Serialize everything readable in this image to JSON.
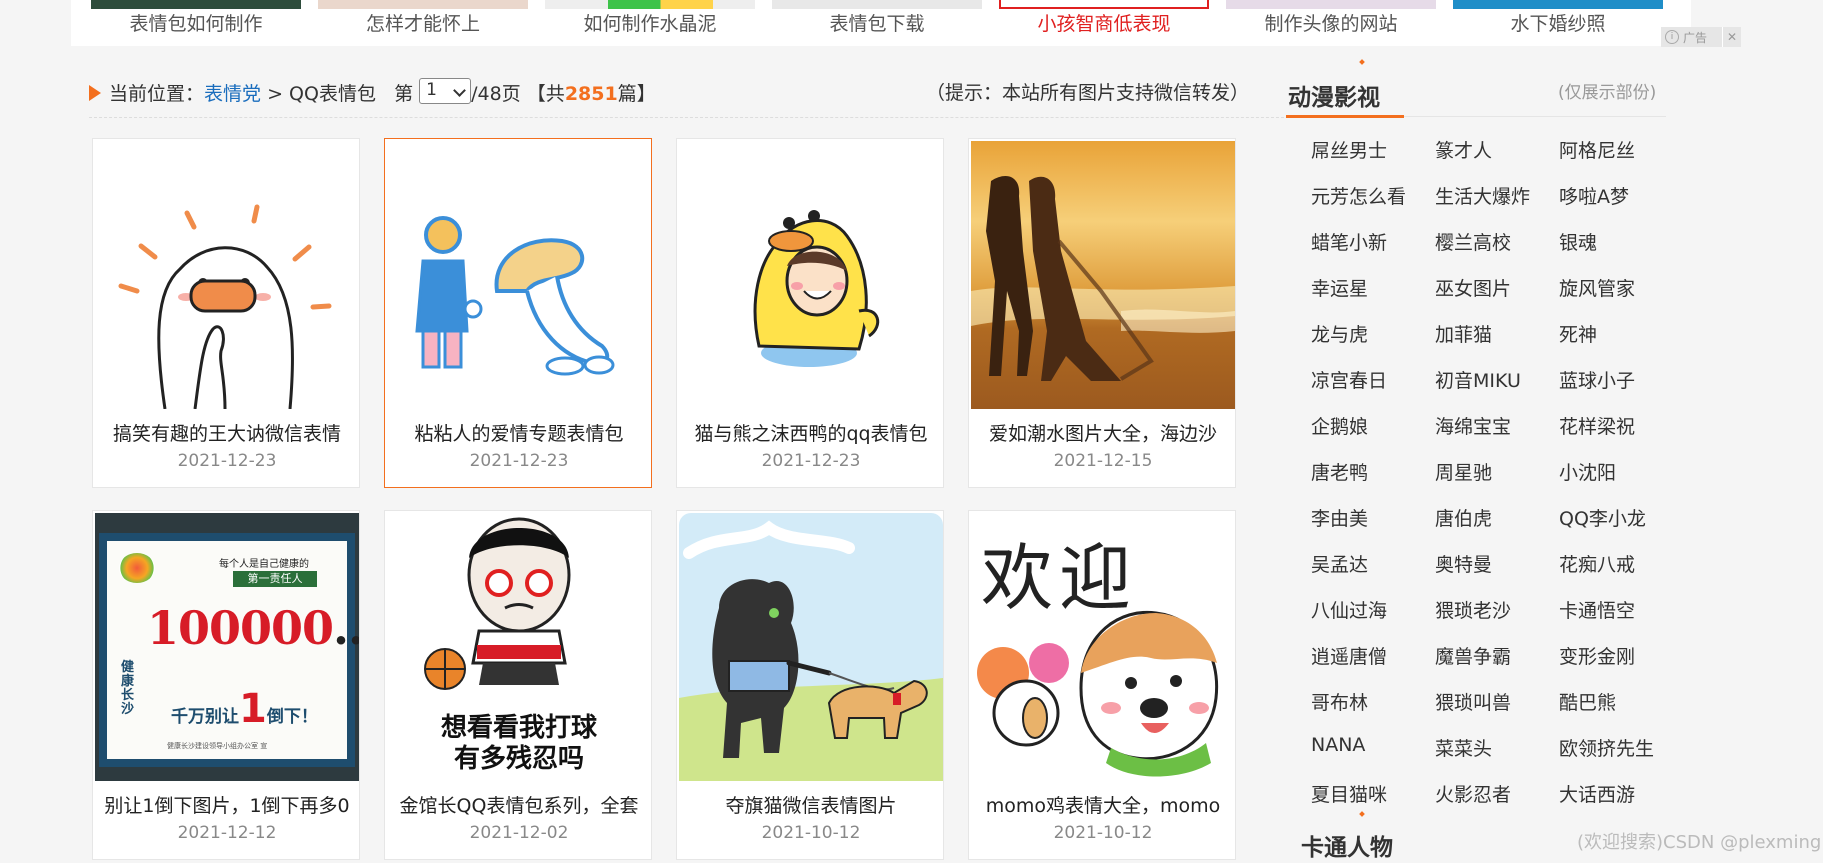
{
  "top_strip": {
    "items": [
      {
        "label": "表情包如何制作",
        "highlight": false
      },
      {
        "label": "怎样才能怀上",
        "highlight": false
      },
      {
        "label": "如何制作水晶泥",
        "highlight": false
      },
      {
        "label": "表情包下载",
        "highlight": false
      },
      {
        "label": "小孩智商低表现",
        "highlight": true
      },
      {
        "label": "制作头像的网站",
        "highlight": false
      },
      {
        "label": "水下婚纱照",
        "highlight": false
      }
    ],
    "ad_label": "广告",
    "ad_close": "✕"
  },
  "breadcrumb": {
    "prefix": "当前位置：",
    "link": "表情党",
    "sep": ">",
    "current": "QQ表情包",
    "page_prefix": "第",
    "page_value": "1",
    "page_suffix": "/48页",
    "total_prefix": "【共",
    "total_count": "2851",
    "total_suffix": "篇】"
  },
  "tip": "（提示：本站所有图片支持微信转发）",
  "cards": [
    {
      "title": "搞笑有趣的王大讷微信表情",
      "date": "2021-12-23"
    },
    {
      "title": "粘粘人的爱情专题表情包",
      "date": "2021-12-23"
    },
    {
      "title": "猫与熊之沫西鸭的qq表情包",
      "date": "2021-12-23"
    },
    {
      "title": "爱如潮水图片大全，海边沙",
      "date": "2021-12-15"
    },
    {
      "title": "别让1倒下图片，1倒下再多0",
      "date": "2021-12-12"
    },
    {
      "title": "金馆长QQ表情包系列，全套",
      "date": "2021-12-02"
    },
    {
      "title": "夺旗猫微信表情图片",
      "date": "2021-10-12"
    },
    {
      "title": "momo鸡表情大全，momo",
      "date": "2021-10-12"
    }
  ],
  "card_images": {
    "poster_text": {
      "top": "每个人是自己健康的",
      "ribbon": "第一责任人",
      "big": "100000",
      "ellipsis": "…",
      "bottom_a": "千万别让",
      "bottom_one": "1",
      "bottom_b": "倒下！",
      "left": "健康长沙",
      "left_vert": "健康长沙",
      "footer": "健康长沙建设领导小组办公室 宣"
    },
    "jin_text": {
      "line1": "想看看我打球",
      "line2": "有多残忍吗"
    },
    "momo_text": "欢迎"
  },
  "sidebar": {
    "title": "动漫影视",
    "note": "(仅展示部份)",
    "items": [
      "屌丝男士",
      "篆才人",
      "阿格尼丝",
      "元芳怎么看",
      "生活大爆炸",
      "哆啦A梦",
      "蜡笔小新",
      "樱兰高校",
      "银魂",
      "幸运星",
      "巫女图片",
      "旋风管家",
      "龙与虎",
      "加菲猫",
      "死神",
      "凉宫春日",
      "初音MIKU",
      "蓝球小子",
      "企鹅娘",
      "海绵宝宝",
      "花样梁祝",
      "唐老鸭",
      "周星驰",
      "小沈阳",
      "李由美",
      "唐伯虎",
      "QQ李小龙",
      "吴孟达",
      "奥特曼",
      "花痴八戒",
      "八仙过海",
      "猥琐老沙",
      "卡通悟空",
      "逍遥唐僧",
      "魔兽争霸",
      "变形金刚",
      "哥布林",
      "猥琐叫兽",
      "酷巴熊",
      "NANA",
      "菜菜头",
      "欧领挤先生",
      "夏目猫咪",
      "火影忍者",
      "大话西游"
    ],
    "title2": "卡通人物"
  },
  "watermark": "(欢迎搜索)CSDN @plexming",
  "colors": {
    "accent": "#f36f1e",
    "link": "#1a6dbd",
    "highlight_red": "#e02020"
  }
}
